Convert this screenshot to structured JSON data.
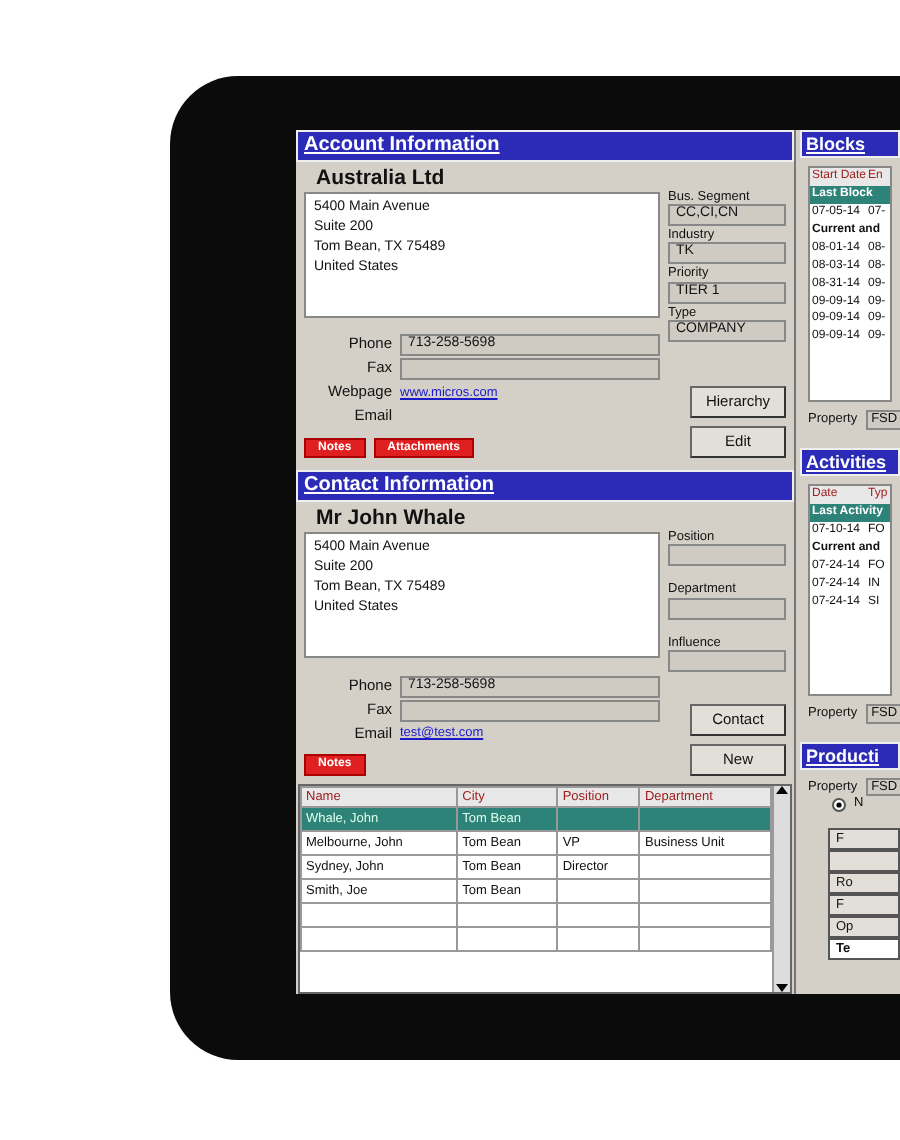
{
  "account": {
    "title": "Account Information",
    "name": "Australia Ltd",
    "address": [
      "5400 Main Avenue",
      "Suite 200",
      "Tom Bean, TX 75489",
      "United States"
    ],
    "fields": [
      {
        "label": "Bus. Segment",
        "value": "CC,CI,CN"
      },
      {
        "label": "Industry",
        "value": "TK"
      },
      {
        "label": "Priority",
        "value": "TIER 1"
      },
      {
        "label": "Type",
        "value": "COMPANY"
      }
    ],
    "details": [
      {
        "label": "Phone",
        "kind": "field",
        "value": "713-258-5698"
      },
      {
        "label": "Fax",
        "kind": "field"
      },
      {
        "label": "Webpage",
        "kind": "link",
        "value": "www.micros.com"
      },
      {
        "label": "Email",
        "kind": "link"
      }
    ],
    "tags": [
      "Notes",
      "Attachments"
    ],
    "buttons": [
      "Hierarchy",
      "Edit"
    ]
  },
  "contact": {
    "title": "Contact Information",
    "name": "Mr John Whale",
    "address": [
      "5400 Main Avenue",
      "Suite 200",
      "Tom Bean, TX 75489",
      "United States"
    ],
    "fields": [
      {
        "label": "Position"
      },
      {
        "label": "Department"
      },
      {
        "label": "Influence"
      }
    ],
    "details": [
      {
        "label": "Phone",
        "kind": "field",
        "value": "713-258-5698"
      },
      {
        "label": "Fax",
        "kind": "field"
      },
      {
        "label": "Email",
        "kind": "link",
        "value": "test@test.com"
      }
    ],
    "tags": [
      "Notes"
    ],
    "buttons": [
      "Contact",
      "New"
    ]
  },
  "contacts_table": {
    "columns": [
      "Name",
      "City",
      "Position",
      "Department"
    ],
    "rows": [
      {
        "cells": [
          "Whale, John",
          "Tom Bean",
          "",
          ""
        ],
        "selected": true
      },
      {
        "cells": [
          "Melbourne, John",
          "Tom Bean",
          "VP",
          "Business Unit"
        ],
        "selected": false
      },
      {
        "cells": [
          "Sydney, John",
          "Tom Bean",
          "Director",
          ""
        ],
        "selected": false
      },
      {
        "cells": [
          "Smith, Joe",
          "Tom Bean",
          "",
          ""
        ],
        "selected": false
      }
    ]
  },
  "blocks": {
    "title": "Blocks",
    "columns": [
      "Start Date",
      "En"
    ],
    "groups": [
      {
        "label": "Last Block",
        "kind": "last",
        "rows": [
          [
            "07-05-14",
            "07-"
          ]
        ]
      },
      {
        "label": "Current and",
        "kind": "current",
        "rows": [
          [
            "08-01-14",
            "08-"
          ],
          [
            "08-03-14",
            "08-"
          ],
          [
            "08-31-14",
            "09-"
          ],
          [
            "09-09-14",
            "09-"
          ],
          [
            "09-09-14",
            "09-"
          ],
          [
            "09-09-14",
            "09-"
          ]
        ]
      }
    ],
    "property": {
      "label": "Property",
      "value": "FSD"
    }
  },
  "activities": {
    "title": "Activities",
    "columns": [
      "Date",
      "Typ"
    ],
    "groups": [
      {
        "label": "Last Activity",
        "kind": "last",
        "rows": [
          [
            "07-10-14",
            "FO"
          ]
        ]
      },
      {
        "label": "Current and",
        "kind": "current",
        "rows": [
          [
            "07-24-14",
            "FO"
          ],
          [
            "07-24-14",
            "IN"
          ],
          [
            "07-24-14",
            "SI"
          ]
        ]
      }
    ],
    "property": {
      "label": "Property",
      "value": "FSD"
    }
  },
  "production": {
    "title": "Producti",
    "property": {
      "label": "Property",
      "value": "FSD"
    },
    "radio": {
      "label": "N",
      "selected": true
    },
    "buttons": [
      {
        "label": "F",
        "kind": "plain"
      },
      {
        "kind": "plain"
      },
      {
        "label": "Ro",
        "kind": "plain"
      },
      {
        "label": "F",
        "kind": "plain"
      },
      {
        "label": "Op",
        "kind": "plain"
      },
      {
        "label": "Te",
        "kind": "active"
      }
    ]
  }
}
